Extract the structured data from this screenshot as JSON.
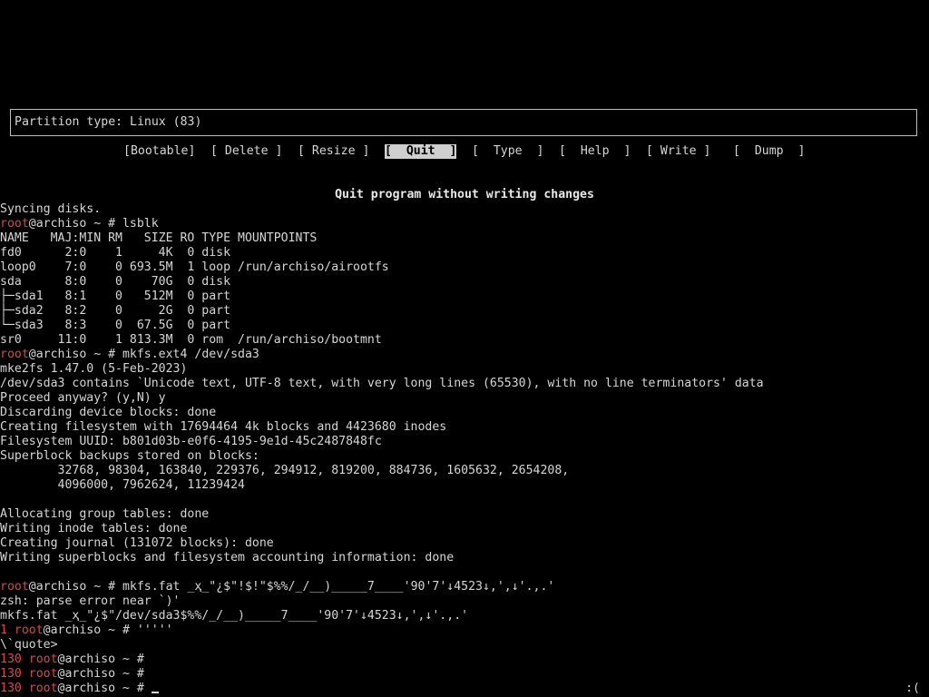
{
  "partition_type": "Partition type: Linux (83)",
  "menu": [
    "[Bootable]",
    "[ Delete ]",
    "[ Resize ]",
    "[  Quit  ]",
    "[  Type  ]",
    "[  Help  ]",
    "[ Write ]",
    "[  Dump  ]"
  ],
  "menu_selected_index": 3,
  "menu_description": "Quit program without writing changes",
  "terminal": {
    "syncing": "Syncing disks.",
    "prompt_user": "root",
    "prompt_host_suffix": "@archiso ~ # ",
    "cmd_lsblk": "lsblk",
    "lsblk_rows": [
      "NAME   MAJ:MIN RM   SIZE RO TYPE MOUNTPOINTS",
      "fd0      2:0    1     4K  0 disk",
      "loop0    7:0    0 693.5M  1 loop /run/archiso/airootfs",
      "sda      8:0    0    70G  0 disk",
      "├─sda1   8:1    0   512M  0 part",
      "├─sda2   8:2    0     2G  0 part",
      "└─sda3   8:3    0  67.5G  0 part",
      "sr0     11:0    1 813.3M  0 rom  /run/archiso/bootmnt"
    ],
    "cmd_mkfs_ext4": "mkfs.ext4 /dev/sda3",
    "mkfs_ext4_output": [
      "mke2fs 1.47.0 (5-Feb-2023)",
      "/dev/sda3 contains `Unicode text, UTF-8 text, with very long lines (65530), with no line terminators' data",
      "Proceed anyway? (y,N) y",
      "Discarding device blocks: done",
      "Creating filesystem with 17694464 4k blocks and 4423680 inodes",
      "Filesystem UUID: b801d03b-e0f6-4195-9e1d-45c2487848fc",
      "Superblock backups stored on blocks:",
      "        32768, 98304, 163840, 229376, 294912, 819200, 884736, 1605632, 2654208,",
      "        4096000, 7962624, 11239424",
      "",
      "Allocating group tables: done",
      "Writing inode tables: done",
      "Creating journal (131072 blocks): done",
      "Writing superblocks and filesystem accounting information: done",
      ""
    ],
    "cmd_mkfs_fat": "mkfs.fat _ҳ_\"¿$\"!$!\"$%%/_/__)_____7____'90'7'↓4523↓,',↓'.,.'",
    "zsh_error": "zsh: parse error near `)'",
    "mkfs_fat_echo": "mkfs.fat _ҳ_\"¿$\"/dev/sda3$%%/_/__)_____7____'90'7'↓4523↓,',↓'.,.'",
    "exit_code_1": "1",
    "cmd_quotes": "'''''",
    "quote_prompt": "\\`quote>",
    "exit_code_130": "130",
    "corner_status": ":("
  }
}
